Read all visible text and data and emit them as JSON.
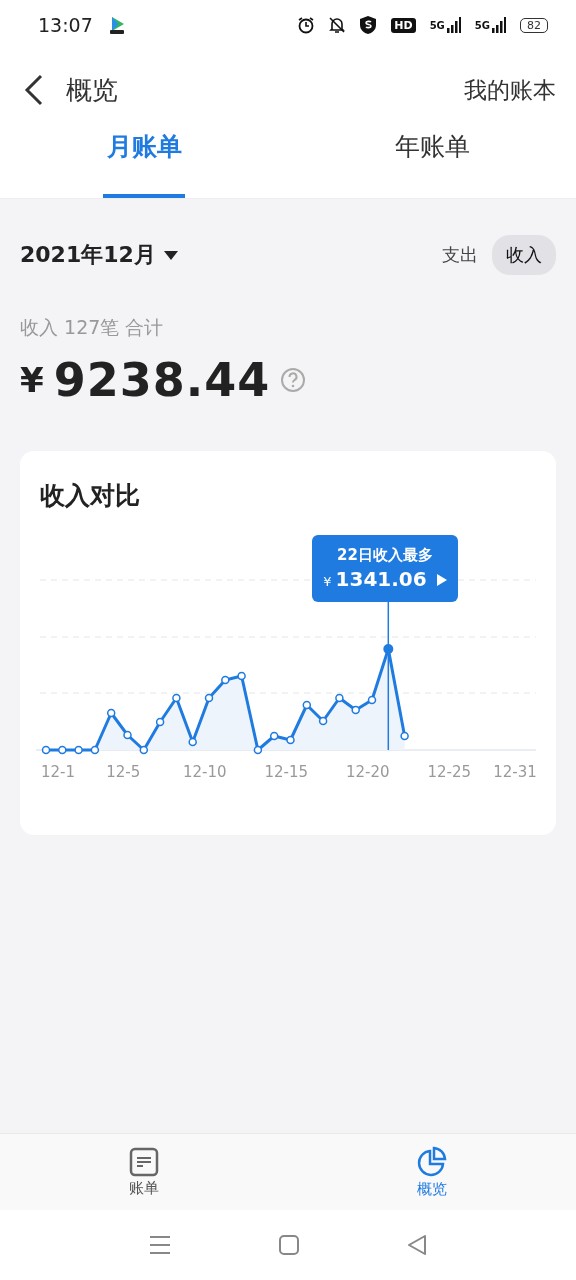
{
  "status_bar": {
    "time": "13:07",
    "hd": "HD",
    "networks": [
      "5G",
      "5G"
    ],
    "battery": "82"
  },
  "header": {
    "title": "概览",
    "action": "我的账本"
  },
  "tabs": [
    {
      "label": "月账单",
      "selected": true
    },
    {
      "label": "年账单",
      "selected": false
    }
  ],
  "period": {
    "label": "2021年12月"
  },
  "type_toggle": [
    {
      "label": "支出",
      "selected": false
    },
    {
      "label": "收入",
      "selected": true
    }
  ],
  "summary": {
    "caption": "收入 127笔 合计",
    "currency": "¥",
    "amount": "9238.44"
  },
  "chart_card": {
    "title": "收入对比",
    "tooltip": {
      "title": "22日收入最多",
      "currency": "¥",
      "amount": "1341.06"
    },
    "x_labels": [
      "12-1",
      "12-5",
      "12-10",
      "12-15",
      "12-20",
      "12-25",
      "12-31"
    ]
  },
  "bottom_nav": [
    {
      "label": "账单",
      "kind": "bill",
      "selected": false
    },
    {
      "label": "概览",
      "kind": "overview",
      "selected": true
    }
  ]
}
